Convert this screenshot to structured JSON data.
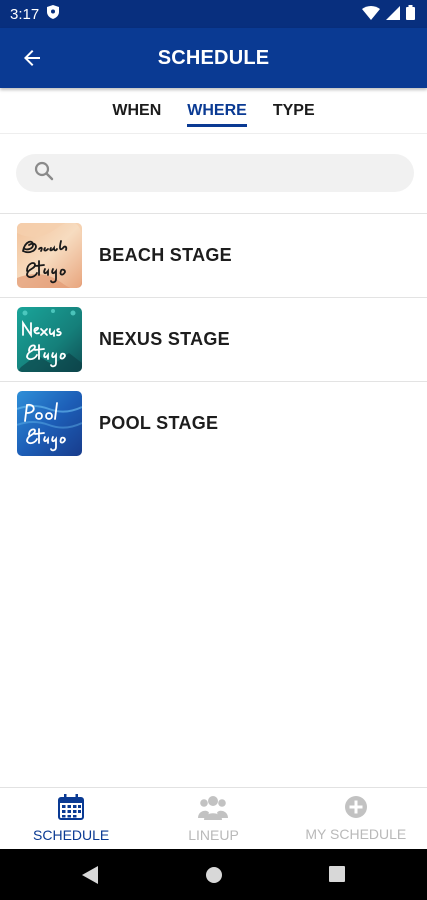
{
  "status": {
    "time": "3:17"
  },
  "header": {
    "title": "SCHEDULE"
  },
  "tabs": [
    {
      "label": "WHEN"
    },
    {
      "label": "WHERE",
      "active": true
    },
    {
      "label": "TYPE"
    }
  ],
  "search": {
    "placeholder": "",
    "value": ""
  },
  "stages": [
    {
      "name": "BEACH STAGE",
      "icon": "beach-stage-logo"
    },
    {
      "name": "NEXUS STAGE",
      "icon": "nexus-stage-logo"
    },
    {
      "name": "POOL STAGE",
      "icon": "pool-stage-logo"
    }
  ],
  "bottom_nav": [
    {
      "label": "SCHEDULE",
      "icon": "calendar-icon",
      "active": true
    },
    {
      "label": "LINEUP",
      "icon": "people-icon"
    },
    {
      "label": "MY SCHEDULE",
      "icon": "plus-circle-icon"
    }
  ],
  "colors": {
    "primary": "#0a3a93",
    "status_bar": "#082f7e",
    "inactive": "#b9b9b9"
  }
}
